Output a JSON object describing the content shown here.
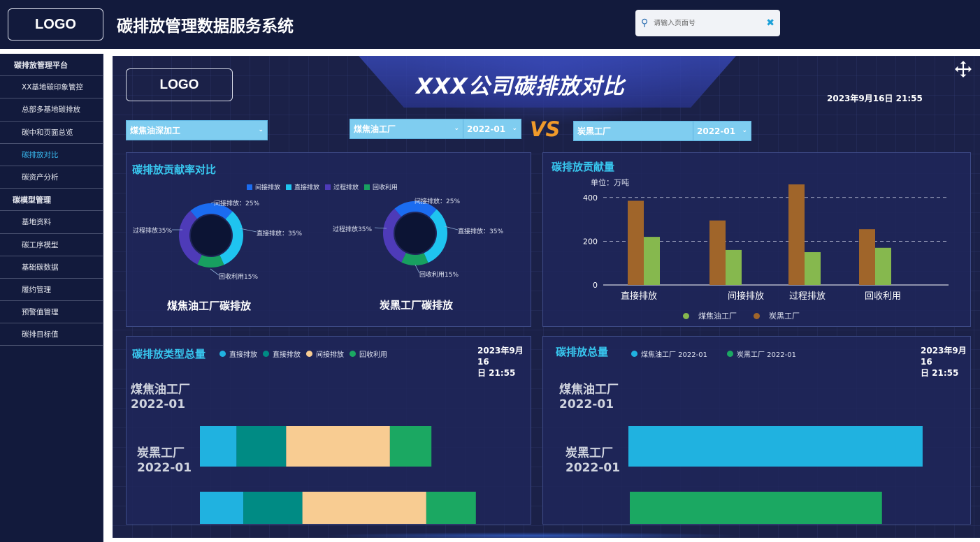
{
  "header": {
    "logo": "LOGO",
    "title": "碳排放管理数据服务系统",
    "search_placeholder": "请输入页面号"
  },
  "sidebar": {
    "groups": [
      {
        "label": "碳排放管理平台",
        "items": [
          "XX基地碳印象管控",
          "总部多基地碳排放",
          "碳中和页面总览",
          "碳排放对比",
          "碳资产分析"
        ]
      },
      {
        "label": "碳模型管理",
        "items": [
          "基地资料",
          "碳工序模型",
          "基础碳数据",
          "履约管理",
          "预警值管理",
          "碳排目标值"
        ]
      }
    ],
    "active": "碳排放对比"
  },
  "main": {
    "logo": "LOGO",
    "title": "XXX公司碳排放对比",
    "datetime": "2023年9月16日 21:55",
    "selects": {
      "process": "煤焦油深加工",
      "left_plant": "煤焦油工厂",
      "left_period": "2022-01",
      "vs": "VS",
      "right_plant": "炭黑工厂",
      "right_period": "2022-01"
    }
  },
  "panels": {
    "contribution_rate": {
      "title": "碳排放贡献率对比",
      "legend": [
        "间接排放",
        "直接排放",
        "过程排放",
        "回收利用"
      ],
      "left_title": "煤焦油工厂碳排放",
      "right_title": "炭黑工厂碳排放",
      "labels": {
        "indirect": "间接排放：25%",
        "direct": "直接排放：35%",
        "process": "过程排放35%",
        "recycle": "回收利用15%"
      }
    },
    "contribution": {
      "title": "碳排放贡献量",
      "unit": "单位：万吨",
      "legend": [
        "煤焦油工厂",
        "炭黑工厂"
      ]
    },
    "type_total": {
      "title": "碳排放类型总量",
      "legend": [
        "直接排放",
        "直接排放",
        "间接排放",
        "回收利用"
      ],
      "datetime_l1": "2023年9月16",
      "datetime_l2": "日 21:55",
      "rows": [
        {
          "l1": "煤焦油工厂",
          "l2": "2022-01"
        },
        {
          "l1": "炭黑工厂",
          "l2": "2022-01"
        }
      ]
    },
    "total": {
      "title": "碳排放总量",
      "legend": [
        "煤焦油工厂 2022-01",
        "炭黑工厂 2022-01"
      ],
      "datetime_l1": "2023年9月16",
      "datetime_l2": "日 21:55",
      "rows": [
        {
          "l1": "煤焦油工厂",
          "l2": "2022-01"
        },
        {
          "l1": "炭黑工厂",
          "l2": "2022-01"
        }
      ]
    }
  },
  "colors": {
    "bg": "#121a3c",
    "panel": "#1e265a",
    "accent": "#38c8f0",
    "brown": "#a0652a",
    "green_light": "#86b84e",
    "cyan": "#20b2e0",
    "teal": "#008b84",
    "peach": "#f8cc92",
    "green": "#1ba862",
    "donut_blue": "#1b6cf0",
    "donut_cyan": "#1fc4f0",
    "donut_purple": "#4e3bb8",
    "donut_green": "#18a060"
  },
  "chart_data": [
    {
      "type": "pie",
      "title": "煤焦油工厂碳排放",
      "categories": [
        "间接排放",
        "直接排放",
        "回收利用",
        "过程排放"
      ],
      "values": [
        25,
        35,
        15,
        35
      ]
    },
    {
      "type": "pie",
      "title": "炭黑工厂碳排放",
      "categories": [
        "间接排放",
        "直接排放",
        "回收利用",
        "过程排放"
      ],
      "values": [
        25,
        35,
        15,
        35
      ]
    },
    {
      "type": "bar",
      "title": "碳排放贡献量",
      "categories": [
        "直接排放",
        "间接排放",
        "过程排放",
        "回收利用"
      ],
      "series": [
        {
          "name": "煤焦油工厂",
          "values": [
            385,
            295,
            460,
            255
          ]
        },
        {
          "name": "炭黑工厂",
          "values": [
            220,
            160,
            150,
            170
          ]
        }
      ],
      "ylim": [
        0,
        460
      ],
      "yticks": [
        0,
        200,
        400
      ],
      "grid": true,
      "legend": "bottom"
    },
    {
      "type": "bar",
      "orientation": "horizontal",
      "stacked": true,
      "title": "碳排放类型总量",
      "categories": [
        "煤焦油工厂 2022-01",
        "炭黑工厂 2022-01"
      ],
      "series": [
        {
          "name": "直接排放",
          "values": [
            135,
            160
          ]
        },
        {
          "name": "直接排放",
          "values": [
            183,
            218
          ]
        },
        {
          "name": "间接排放",
          "values": [
            383,
            457
          ]
        },
        {
          "name": "回收利用",
          "values": [
            153,
            183
          ]
        }
      ],
      "xlim": [
        0,
        1150
      ],
      "xticks": [
        0,
        200,
        400,
        600,
        800,
        1000
      ],
      "legend": "top"
    },
    {
      "type": "bar",
      "orientation": "horizontal",
      "title": "碳排放总量",
      "categories": [
        "煤焦油工厂 2022-01",
        "炭黑工厂 2022-01"
      ],
      "series": [
        {
          "name": "煤焦油工厂 2022-01",
          "values": [
            1015,
            0
          ]
        },
        {
          "name": "炭黑工厂 2022-01",
          "values": [
            0,
            870
          ]
        }
      ],
      "xlim": [
        0,
        1090
      ],
      "xticks": [
        0,
        200,
        400,
        600,
        800,
        1000
      ],
      "legend": "top"
    }
  ]
}
